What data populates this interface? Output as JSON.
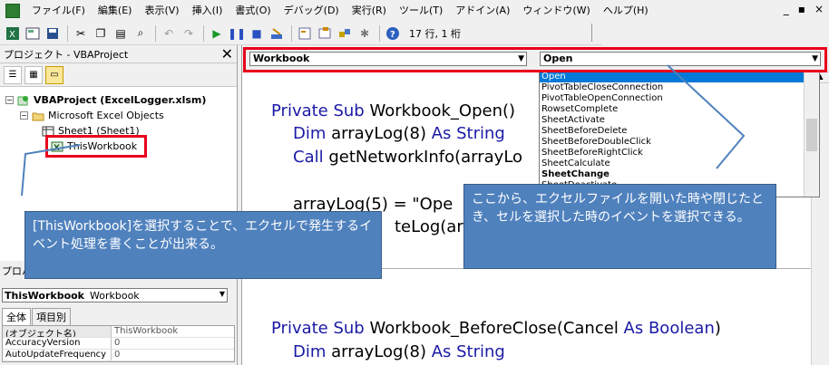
{
  "menubar": {
    "items": [
      "ファイル(F)",
      "編集(E)",
      "表示(V)",
      "挿入(I)",
      "書式(O)",
      "デバッグ(D)",
      "実行(R)",
      "ツール(T)",
      "アドイン(A)",
      "ウィンドウ(W)",
      "ヘルプ(H)"
    ],
    "window_controls": [
      "_",
      "▪",
      "×"
    ]
  },
  "toolbar": {
    "position_text": "17 行, 1 桁"
  },
  "project_explorer": {
    "title": "プロジェクト - VBAProject",
    "close": "✕",
    "tree": {
      "project": "VBAProject (ExcelLogger.xlsm)",
      "folder": "Microsoft Excel Objects",
      "sheet": "Sheet1 (Sheet1)",
      "workbook": "ThisWorkbook"
    }
  },
  "properties": {
    "title": "プロパ",
    "object_name": "ThisWorkbook",
    "object_type": "Workbook",
    "tabs": [
      "全体",
      "項目別"
    ],
    "rows": [
      {
        "key": "(オブジェクト名)",
        "value": "ThisWorkbook"
      },
      {
        "key": "AccuracyVersion",
        "value": "0"
      },
      {
        "key": "AutoUpdateFrequency",
        "value": "0"
      }
    ]
  },
  "code_window": {
    "object_combo": "Workbook",
    "procedure_combo": "Open",
    "code": {
      "l1_kw": "Private Sub",
      "l1_rest": " Workbook_Open()",
      "l2_kw": "Dim",
      "l2_mid": " arrayLog(8) ",
      "l2_kw2": "As String",
      "l3_kw": "Call",
      "l3_rest": " getNetworkInfo(arrayLo",
      "l4": "arrayLog(5) = \"Ope",
      "l5": "teLog(ar",
      "l6_kw": "Private Sub",
      "l6_rest": " Workbook_BeforeClose(Cancel ",
      "l6_kw2": "As Boolean",
      "l6_end": ")",
      "l7_kw": "Dim",
      "l7_mid": " arrayLog(8) ",
      "l7_kw2": "As String"
    },
    "events": [
      "Open",
      "PivotTableCloseConnection",
      "PivotTableOpenConnection",
      "RowsetComplete",
      "SheetActivate",
      "SheetBeforeDelete",
      "SheetBeforeDoubleClick",
      "SheetBeforeRightClick",
      "SheetCalculate",
      "SheetChange",
      "SheetDeactivate"
    ],
    "selected_event": "Open"
  },
  "callouts": {
    "left": "[ThisWorkbook]を選択することで、エクセルで発生するイベント処理を書くことが出来る。",
    "right": "ここから、エクセルファイルを開いた時や閉じたとき、セルを選択した時のイベントを選択できる。"
  },
  "colors": {
    "keyword": "#1a1aa6",
    "highlight_border": "#e8001c",
    "callout_fill": "#4f81bd",
    "selection": "#0078d7"
  }
}
